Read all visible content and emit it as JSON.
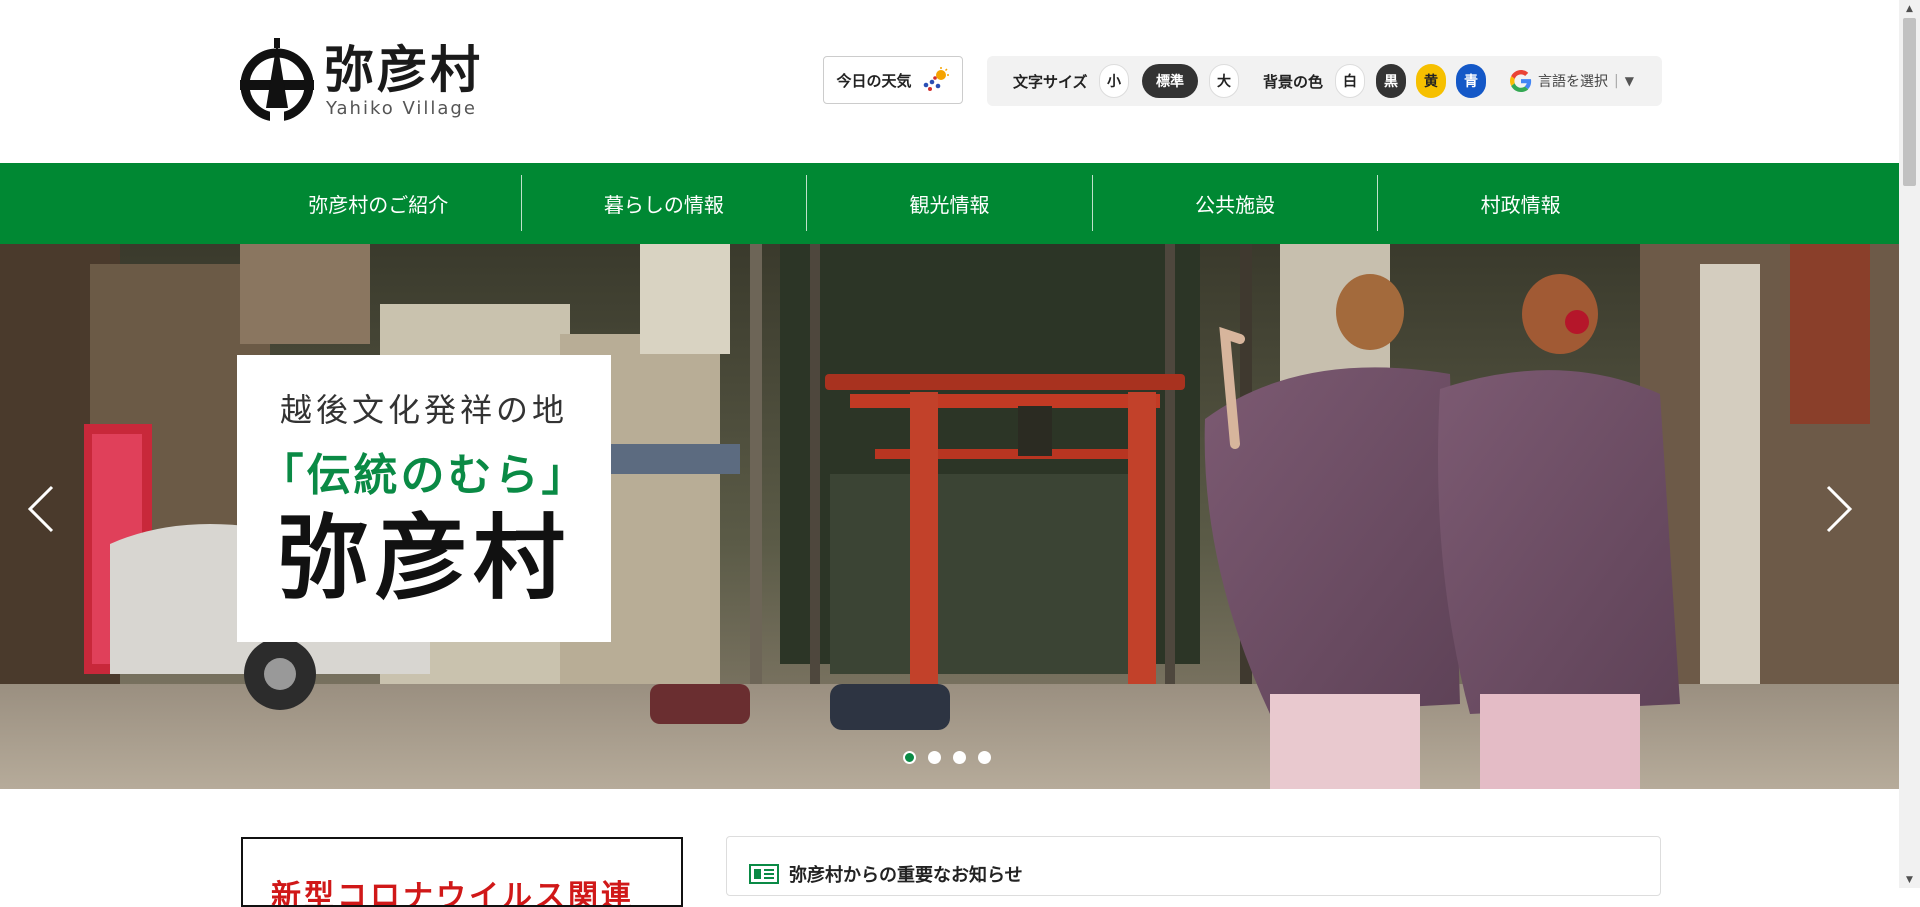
{
  "header": {
    "logo_title": "弥彦村",
    "logo_subtitle": "Yahiko Village",
    "weather_label": "今日の天気",
    "font_size_label": "文字サイズ",
    "font_size_options": [
      "小",
      "標準",
      "大"
    ],
    "bg_color_label": "背景の色",
    "bg_color_options": [
      "白",
      "黒",
      "黄",
      "青"
    ],
    "language_label": "言語を選択"
  },
  "nav": {
    "items": [
      "弥彦村のご紹介",
      "暮らしの情報",
      "観光情報",
      "公共施設",
      "村政情報"
    ]
  },
  "hero": {
    "line1": "越後文化発祥の地",
    "line2": "「伝統のむら」",
    "line3": "弥彦村",
    "slide_count": 4,
    "active_slide": 1
  },
  "sections": {
    "covid_title": "新型コロナウイルス関連",
    "notice_title": "弥彦村からの重要なお知らせ"
  },
  "colors": {
    "brand_green": "#008833",
    "accent_green": "#0a8a45",
    "alert_red": "#d01818"
  }
}
